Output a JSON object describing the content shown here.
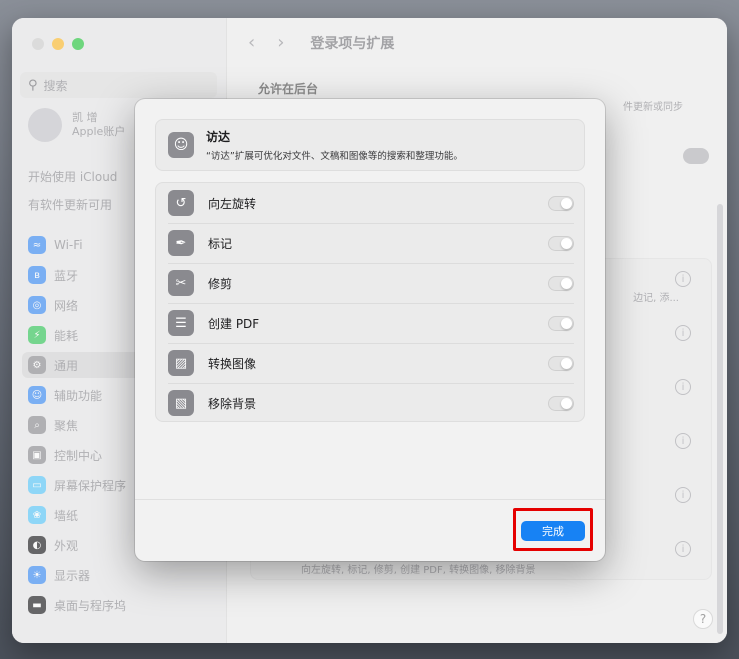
{
  "window": {
    "title": "登录项与扩展",
    "search_placeholder": "搜索",
    "account": {
      "name": "凯 增",
      "subtitle": "Apple账户"
    },
    "sidebar_links": [
      "开始使用 iCloud",
      "有软件更新可用"
    ],
    "sidebar_items": [
      {
        "label": "Wi-Fi",
        "icon": "wifi-icon",
        "color": "#3b8cf5"
      },
      {
        "label": "蓝牙",
        "icon": "bluetooth-icon",
        "color": "#3b8cf5"
      },
      {
        "label": "网络",
        "icon": "globe-icon",
        "color": "#3b8cf5"
      },
      {
        "label": "能耗",
        "icon": "battery-icon",
        "color": "#34c759"
      },
      {
        "label": "通用",
        "icon": "gear-icon",
        "color": "#8e8e93"
      },
      {
        "label": "辅助功能",
        "icon": "accessibility-icon",
        "color": "#3b8cf5"
      },
      {
        "label": "聚焦",
        "icon": "search-icon",
        "color": "#8e8e93"
      },
      {
        "label": "控制中心",
        "icon": "control-center-icon",
        "color": "#8e8e93"
      },
      {
        "label": "屏幕保护程序",
        "icon": "screensaver-icon",
        "color": "#5ac8fa"
      },
      {
        "label": "墙纸",
        "icon": "wallpaper-icon",
        "color": "#5ac8fa"
      },
      {
        "label": "外观",
        "icon": "appearance-icon",
        "color": "#1d1d1f"
      },
      {
        "label": "显示器",
        "icon": "display-icon",
        "color": "#3b8cf5"
      },
      {
        "label": "桌面与程序坞",
        "icon": "dock-icon",
        "color": "#1d1d1f"
      }
    ],
    "selected_item": "通用",
    "section_title": "允许在后台",
    "snippet_top": "件更新或同步",
    "snippet_mid": "边记, 添...",
    "snippet_bottom": "向左旋转, 标记, 修剪, 创建 PDF, 转换图像, 移除背景"
  },
  "sheet": {
    "header": {
      "title": "访达",
      "description": "“访达”扩展可优化对文件、文稿和图像等的搜索和整理功能。",
      "icon": "finder-icon"
    },
    "extensions": [
      {
        "label": "向左旋转",
        "icon": "rotate-left-icon",
        "enabled": false
      },
      {
        "label": "标记",
        "icon": "markup-icon",
        "enabled": false
      },
      {
        "label": "修剪",
        "icon": "trim-icon",
        "enabled": false
      },
      {
        "label": "创建 PDF",
        "icon": "pdf-icon",
        "enabled": false
      },
      {
        "label": "转换图像",
        "icon": "convert-image-icon",
        "enabled": false
      },
      {
        "label": "移除背景",
        "icon": "remove-background-icon",
        "enabled": false
      }
    ],
    "done_label": "完成"
  },
  "colors": {
    "accent": "#1782f4",
    "highlight": "#e50000"
  }
}
